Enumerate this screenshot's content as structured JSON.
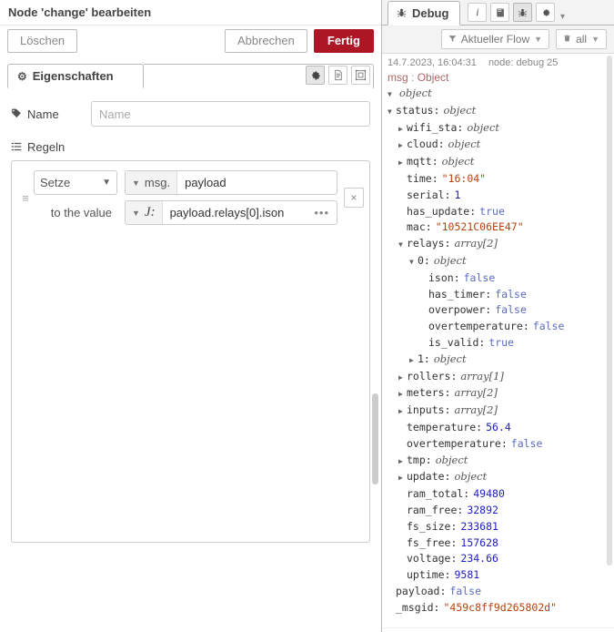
{
  "editor": {
    "title": "Node 'change' bearbeiten",
    "buttons": {
      "delete": "Löschen",
      "cancel": "Abbrechen",
      "done": "Fertig"
    },
    "tab": {
      "label": "Eigenschaften",
      "icon": "gear-icon"
    },
    "tab_buttons": [
      {
        "name": "settings-icon",
        "glyph": "⚙"
      },
      {
        "name": "description-icon",
        "glyph": "὜E"
      },
      {
        "name": "appearance-icon",
        "glyph": "▣"
      }
    ],
    "form": {
      "name_label": "Name",
      "name_placeholder": "Name",
      "name_value": "",
      "rules_label": "Regeln"
    },
    "rule": {
      "action": "Setze",
      "prop_type": "msg.",
      "prop_value": "payload",
      "to_label": "to the value",
      "value_type": "J:",
      "value_expression": "payload.relays[0].ison",
      "expand_glyph": "•••",
      "delete_glyph": "×",
      "drag_glyph": "≡"
    }
  },
  "sidebar": {
    "tab_label": "Debug",
    "tab_icon": "bug-icon",
    "tools": [
      {
        "name": "info-icon",
        "glyph": "i",
        "active": false
      },
      {
        "name": "help-book-icon",
        "glyph": "⌸",
        "active": false
      },
      {
        "name": "debug-bug-icon",
        "glyph": "☣",
        "active": true
      },
      {
        "name": "config-gear-icon",
        "glyph": "⚙",
        "active": false
      }
    ],
    "caret_glyph": "▾",
    "filters": {
      "flow_filter": "Aktueller Flow",
      "flow_icon": "filter-icon",
      "clear_label": "all",
      "clear_icon": "trash-icon"
    },
    "message": {
      "timestamp": "14.7.2023, 16:04:31",
      "node": "node: debug 25",
      "topic_key": "msg",
      "topic_sep": " : ",
      "topic_type": "Object"
    },
    "tree": [
      {
        "indent": 0,
        "toggle": "open",
        "key": "",
        "type": "object",
        "value": null,
        "kind": "type"
      },
      {
        "indent": 0,
        "toggle": "open",
        "key": "status",
        "type": "object",
        "value": null,
        "kind": "type"
      },
      {
        "indent": 1,
        "toggle": "closed",
        "key": "wifi_sta",
        "type": "object",
        "value": null,
        "kind": "type"
      },
      {
        "indent": 1,
        "toggle": "closed",
        "key": "cloud",
        "type": "object",
        "value": null,
        "kind": "type"
      },
      {
        "indent": 1,
        "toggle": "closed",
        "key": "mqtt",
        "type": "object",
        "value": null,
        "kind": "type"
      },
      {
        "indent": 1,
        "toggle": "none",
        "key": "time",
        "type": null,
        "value": "\"16:04\"",
        "kind": "str"
      },
      {
        "indent": 1,
        "toggle": "none",
        "key": "serial",
        "type": null,
        "value": "1",
        "kind": "num"
      },
      {
        "indent": 1,
        "toggle": "none",
        "key": "has_update",
        "type": null,
        "value": "true",
        "kind": "bool"
      },
      {
        "indent": 1,
        "toggle": "none",
        "key": "mac",
        "type": null,
        "value": "\"10521C06EE47\"",
        "kind": "str"
      },
      {
        "indent": 1,
        "toggle": "open",
        "key": "relays",
        "type": "array[2]",
        "value": null,
        "kind": "type"
      },
      {
        "indent": 2,
        "toggle": "open",
        "key": "0",
        "type": "object",
        "value": null,
        "kind": "type"
      },
      {
        "indent": 3,
        "toggle": "none",
        "key": "ison",
        "type": null,
        "value": "false",
        "kind": "bool"
      },
      {
        "indent": 3,
        "toggle": "none",
        "key": "has_timer",
        "type": null,
        "value": "false",
        "kind": "bool"
      },
      {
        "indent": 3,
        "toggle": "none",
        "key": "overpower",
        "type": null,
        "value": "false",
        "kind": "bool"
      },
      {
        "indent": 3,
        "toggle": "none",
        "key": "overtemperature",
        "type": null,
        "value": "false",
        "kind": "bool"
      },
      {
        "indent": 3,
        "toggle": "none",
        "key": "is_valid",
        "type": null,
        "value": "true",
        "kind": "bool"
      },
      {
        "indent": 2,
        "toggle": "closed",
        "key": "1",
        "type": "object",
        "value": null,
        "kind": "type"
      },
      {
        "indent": 1,
        "toggle": "closed",
        "key": "rollers",
        "type": "array[1]",
        "value": null,
        "kind": "type"
      },
      {
        "indent": 1,
        "toggle": "closed",
        "key": "meters",
        "type": "array[2]",
        "value": null,
        "kind": "type"
      },
      {
        "indent": 1,
        "toggle": "closed",
        "key": "inputs",
        "type": "array[2]",
        "value": null,
        "kind": "type"
      },
      {
        "indent": 1,
        "toggle": "none",
        "key": "temperature",
        "type": null,
        "value": "56.4",
        "kind": "num"
      },
      {
        "indent": 1,
        "toggle": "none",
        "key": "overtemperature",
        "type": null,
        "value": "false",
        "kind": "bool"
      },
      {
        "indent": 1,
        "toggle": "closed",
        "key": "tmp",
        "type": "object",
        "value": null,
        "kind": "type"
      },
      {
        "indent": 1,
        "toggle": "closed",
        "key": "update",
        "type": "object",
        "value": null,
        "kind": "type"
      },
      {
        "indent": 1,
        "toggle": "none",
        "key": "ram_total",
        "type": null,
        "value": "49480",
        "kind": "num"
      },
      {
        "indent": 1,
        "toggle": "none",
        "key": "ram_free",
        "type": null,
        "value": "32892",
        "kind": "num"
      },
      {
        "indent": 1,
        "toggle": "none",
        "key": "fs_size",
        "type": null,
        "value": "233681",
        "kind": "num"
      },
      {
        "indent": 1,
        "toggle": "none",
        "key": "fs_free",
        "type": null,
        "value": "157628",
        "kind": "num"
      },
      {
        "indent": 1,
        "toggle": "none",
        "key": "voltage",
        "type": null,
        "value": "234.66",
        "kind": "num"
      },
      {
        "indent": 1,
        "toggle": "none",
        "key": "uptime",
        "type": null,
        "value": "9581",
        "kind": "num"
      },
      {
        "indent": 0,
        "toggle": "none",
        "key": "payload",
        "type": null,
        "value": "false",
        "kind": "bool"
      },
      {
        "indent": 0,
        "toggle": "none",
        "key": "_msgid",
        "type": null,
        "value": "\"459c8ff9d265802d\"",
        "kind": "str"
      }
    ]
  },
  "colors": {
    "primary_red": "#ad1625",
    "panel_bg": "#f3f3f3",
    "string": "#b7410e",
    "number": "#2020c0",
    "boolean": "#5c6bc0"
  }
}
